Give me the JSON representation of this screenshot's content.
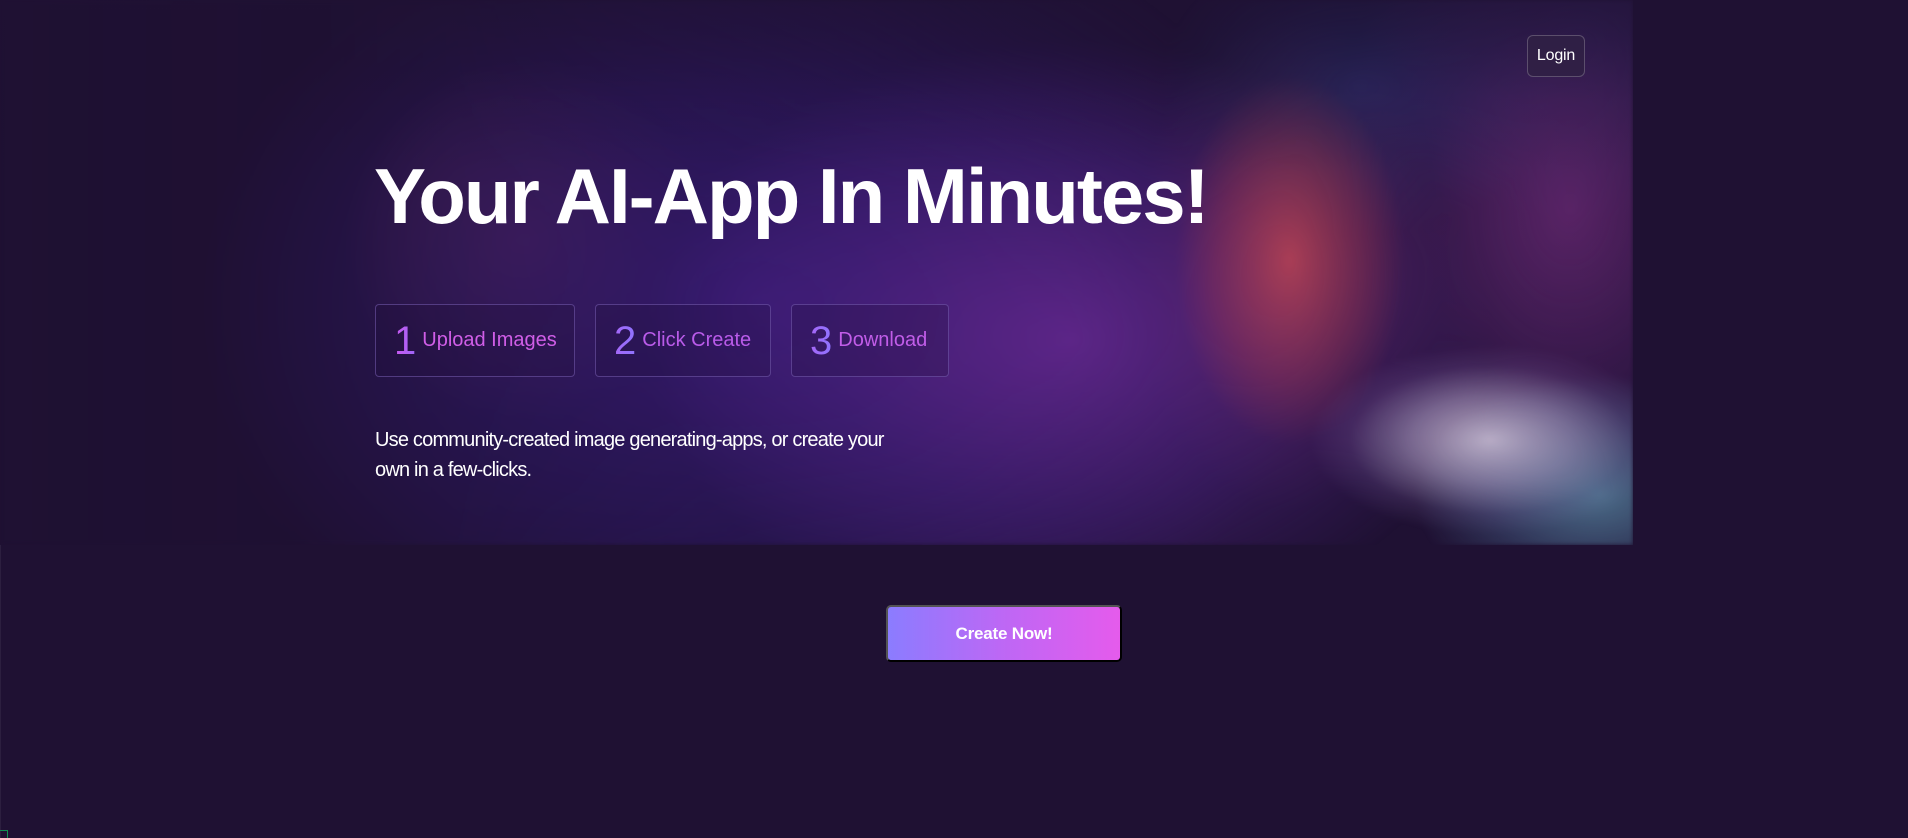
{
  "header": {
    "login_label": "Login"
  },
  "hero": {
    "title": "Your AI-App In Minutes!",
    "steps": [
      {
        "number": "1",
        "label": "Upload Images"
      },
      {
        "number": "2",
        "label": "Click Create"
      },
      {
        "number": "3",
        "label": "Download"
      }
    ],
    "description": "Use community-created image generating-apps, or create your own in a few-clicks."
  },
  "cta": {
    "label": "Create Now!"
  },
  "colors": {
    "background": "#1f1133",
    "title": "#ffffff",
    "step_text": "#d05ee7",
    "button_start": "#8b7cff",
    "button_end": "#e55bec",
    "login_border": "#5f5270"
  }
}
